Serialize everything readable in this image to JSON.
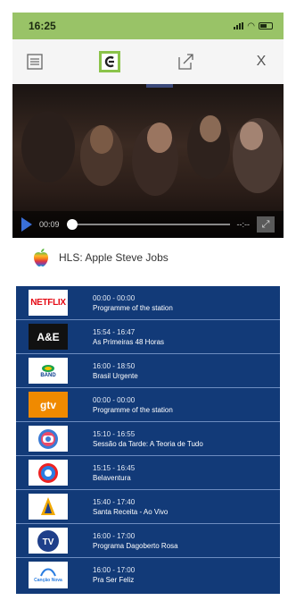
{
  "status": {
    "time": "16:25"
  },
  "toolbar": {
    "close_label": "X"
  },
  "player": {
    "elapsed": "00:09",
    "remaining": "--:--",
    "progress": 0
  },
  "now_playing": {
    "title": "HLS: Apple Steve Jobs"
  },
  "channels": [
    {
      "logo": "NETFLIX",
      "time": "00:00 - 00:00",
      "program": "Programme of the station"
    },
    {
      "logo": "A&E",
      "time": "15:54 - 16:47",
      "program": "As Primeiras 48 Horas"
    },
    {
      "logo": "BAND",
      "time": "16:00 - 18:50",
      "program": "Brasil Urgente"
    },
    {
      "logo": "gtv",
      "time": "00:00 - 00:00",
      "program": "Programme of the station"
    },
    {
      "logo": "Globo",
      "time": "15:10 - 16:55",
      "program": "Sessão da Tarde: A Teoria de Tudo"
    },
    {
      "logo": "Record",
      "time": "15:15 - 16:45",
      "program": "Belaventura"
    },
    {
      "logo": "Aparecida",
      "time": "15:40 - 17:40",
      "program": "Santa Receita - Ao Vivo"
    },
    {
      "logo": "TV",
      "time": "16:00 - 17:00",
      "program": "Programa Dagoberto Rosa"
    },
    {
      "logo": "Canção Nova",
      "time": "16:00 - 17:00",
      "program": "Pra Ser Feliz"
    }
  ]
}
